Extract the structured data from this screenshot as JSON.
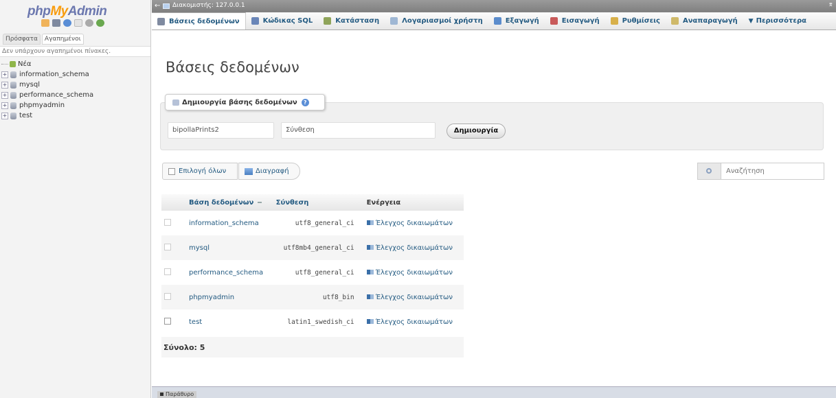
{
  "sidebar": {
    "logo": {
      "part1": "php",
      "part2": "My",
      "part3": "Admin"
    },
    "tabs": [
      "Πρόσφατα",
      "Αγαπημένοι"
    ],
    "no_favorites": "Δεν υπάρχουν αγαπημένοι πίνακες.",
    "new_label": "Νέα",
    "databases": [
      "information_schema",
      "mysql",
      "performance_schema",
      "phpmyadmin",
      "test"
    ],
    "quick_icons": [
      "home-icon",
      "database-icon",
      "help-icon",
      "docs-icon",
      "settings-icon",
      "reload-icon"
    ]
  },
  "server_bar": {
    "back": "←",
    "label": "Διακομιστής: 127.0.0.1",
    "collapse": "⌆"
  },
  "menu": {
    "items": [
      {
        "label": "Βάσεις δεδομένων",
        "icon": "database-icon",
        "color": "#7f8aa0"
      },
      {
        "label": "Κώδικας SQL",
        "icon": "sql-icon",
        "color": "#6a86b8"
      },
      {
        "label": "Κατάσταση",
        "icon": "status-icon",
        "color": "#8fa45a"
      },
      {
        "label": "Λογαριασμοί χρήστη",
        "icon": "users-icon",
        "color": "#9fb7d4"
      },
      {
        "label": "Εξαγωγή",
        "icon": "export-icon",
        "color": "#5b8ccc"
      },
      {
        "label": "Εισαγωγή",
        "icon": "import-icon",
        "color": "#c85a5a"
      },
      {
        "label": "Ρυθμίσεις",
        "icon": "settings-icon",
        "color": "#d8b04a"
      },
      {
        "label": "Αναπαραγωγή",
        "icon": "replication-icon",
        "color": "#cfb96a"
      },
      {
        "label": "Περισσότερα",
        "icon": "more-icon",
        "color": ""
      }
    ]
  },
  "main": {
    "title": "Βάσεις δεδομένων",
    "create": {
      "legend": "Δημιουργία βάσης δεδομένων",
      "db_name_value": "bipollaPrints2",
      "collation_value": "Σύνθεση",
      "button": "Δημιουργία"
    },
    "check_all": "Επιλογή όλων",
    "drop": "Διαγραφή",
    "search_placeholder": "Αναζήτηση",
    "table": {
      "headers": [
        "Βάση δεδομένων",
        "Σύνθεση",
        "Ενέργεια"
      ],
      "rows": [
        {
          "name": "information_schema",
          "collation": "utf8_general_ci",
          "action": "Έλεγχος δικαιωμάτων"
        },
        {
          "name": "mysql",
          "collation": "utf8mb4_general_ci",
          "action": "Έλεγχος δικαιωμάτων"
        },
        {
          "name": "performance_schema",
          "collation": "utf8_general_ci",
          "action": "Έλεγχος δικαιωμάτων"
        },
        {
          "name": "phpmyadmin",
          "collation": "utf8_bin",
          "action": "Έλεγχος δικαιωμάτων"
        },
        {
          "name": "test",
          "collation": "latin1_swedish_ci",
          "action": "Έλεγχος δικαιωμάτων"
        }
      ],
      "total": "Σύνολο: 5"
    }
  },
  "console": {
    "label": "Παράθυρο"
  }
}
